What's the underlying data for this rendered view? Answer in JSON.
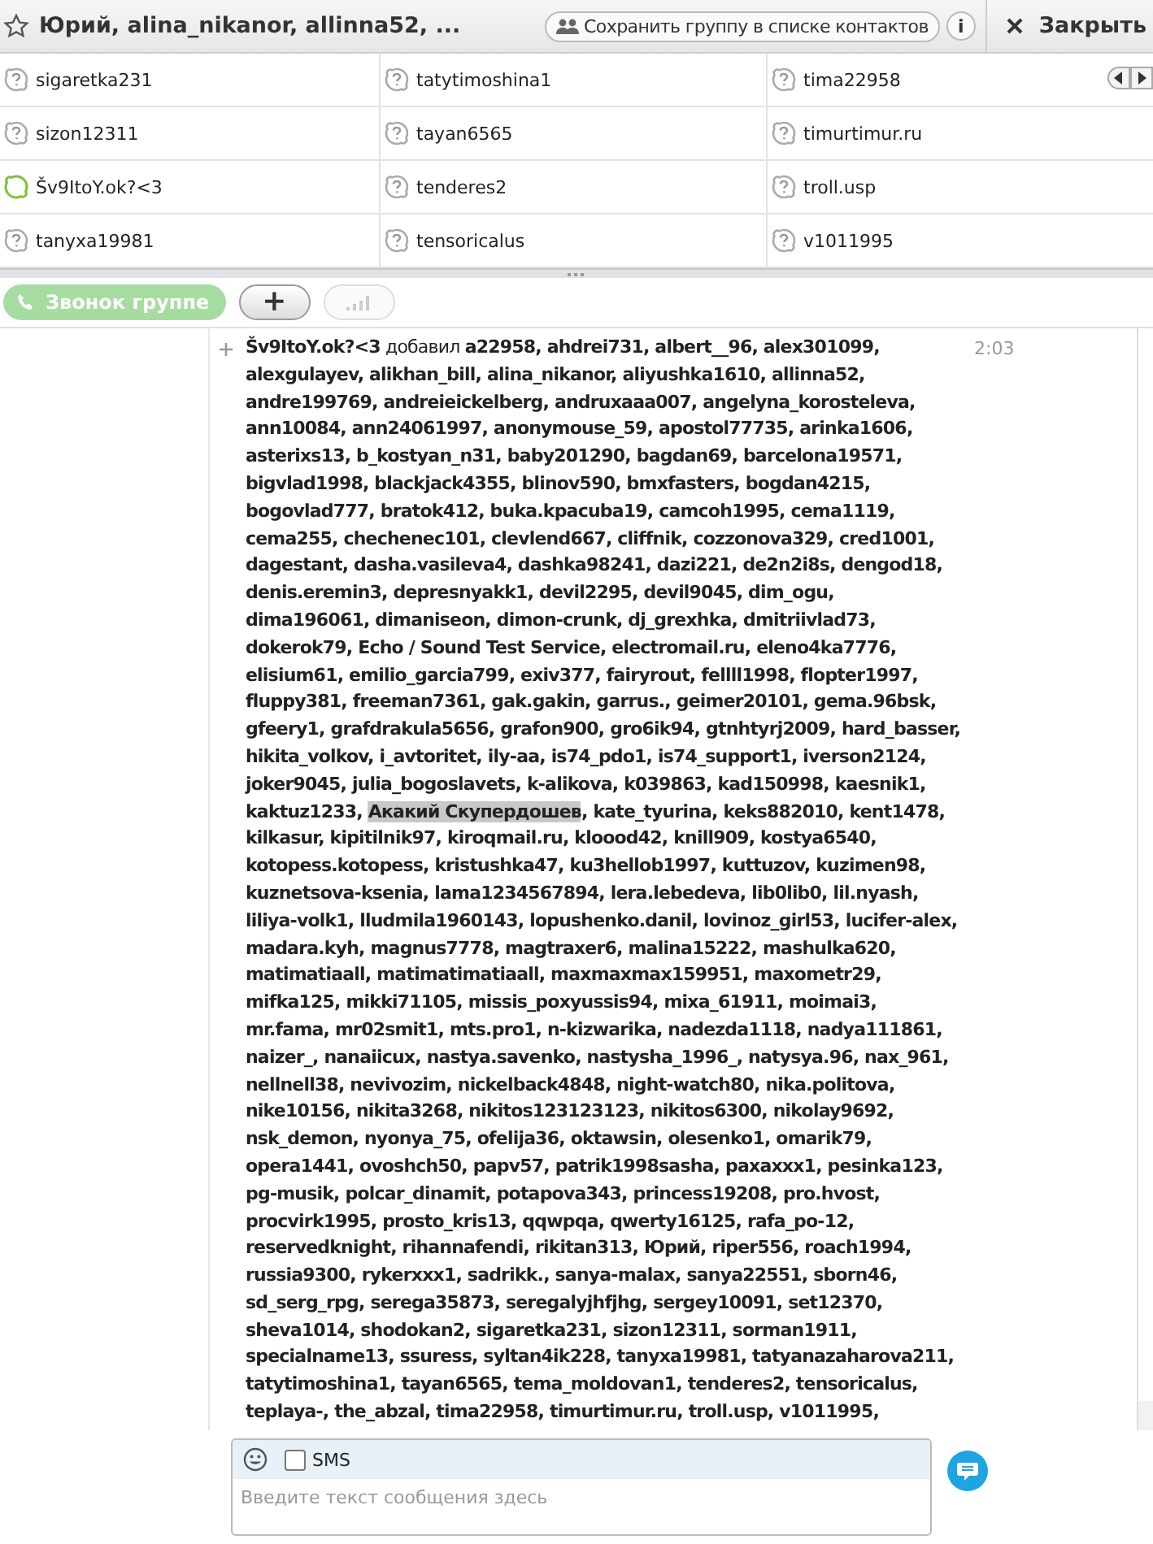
{
  "header": {
    "title": "Юрий, alina_nikanor, allinna52, ...",
    "save_button": "Сохранить группу в списке контактов",
    "info_button": "i",
    "close_button": "Закрыть"
  },
  "contacts": [
    {
      "name": "sigaretka231",
      "kind": "unknown"
    },
    {
      "name": "tatytimoshina1",
      "kind": "unknown"
    },
    {
      "name": "tima22958",
      "kind": "unknown"
    },
    {
      "name": "sizon12311",
      "kind": "unknown"
    },
    {
      "name": "tayan6565",
      "kind": "unknown"
    },
    {
      "name": "timurtimur.ru",
      "kind": "unknown"
    },
    {
      "name": "Šv9ItoY.ok?<3",
      "kind": "online"
    },
    {
      "name": "tenderes2",
      "kind": "unknown"
    },
    {
      "name": "troll.usp",
      "kind": "unknown"
    },
    {
      "name": "tanyxa19981",
      "kind": "unknown"
    },
    {
      "name": "tensoricalus",
      "kind": "unknown"
    },
    {
      "name": "v1011995",
      "kind": "unknown"
    }
  ],
  "toolbar": {
    "call_button": {
      "label": "Звонок группе",
      "disabled": true
    },
    "add_button": {
      "label": "+",
      "disabled": false
    },
    "quality_button": {
      "disabled": true
    }
  },
  "message": {
    "sender": "Šv9ItoY.ok?<3",
    "action": "добавил",
    "names_before": "a22958, ahdrei731, albert__96, alex301099, alexgulayev, alikhan_bill, alina_nikanor, aliyushka1610, allinna52, andre199769, andreieickelberg, andruxaaa007, angelyna_korosteleva, ann10084, ann24061997, anonymouse_59, apostol77735, arinka1606, asterixs13, b_kostyan_n31, baby201290, bagdan69, barcelona19571, bigvlad1998, blackjack4355, blinov590, bmxfasters, bogdan4215, bogovlad777, bratok412, buka.kpacuba19, camcoh1995, cema1119, cema255, chechenec101, clevlend667, cliffnik, cozzonova329, cred1001, dagestant, dasha.vasileva4, dashka98241, dazi221, de2n2i8s, dengod18, denis.eremin3, depresnyakk1, devil2295, devil9045, dim_ogu, dima196061, dimaniseon, dimon-crunk, dj_grexhka, dmitriivlad73, dokerok79, Echo / Sound Test Service, electromail.ru, eleno4ka7776, elisium61, emilio_garcia799, exiv377, fairyrout, fellll1998, flopter1997, fluppy381, freeman7361, gak.gakin, garrus., geimer20101, gema.96bsk, gfeery1, grafdrakula5656, grafon900, gro6ik94, gtnhtyrj2009, hard_basser, hikita_volkov, i_avtoritet, ily-aa, is74_pdo1, is74_support1, iverson2124, joker9045, julia_bogoslavets, k-alikova, k039863, kad150998, kaesnik1, kaktuz1233, ",
    "highlight": "Акакий Скупердошев",
    "names_after": ", kate_tyurina, keks882010, kent1478, kilkasur, kipitilnik97, kiroqmail.ru, kloood42, knill909, kostya6540, kotopess.kotopess, kristushka47, ku3hellob1997, kuttuzov, kuzimen98, kuznetsova-ksenia, lama1234567894, lera.lebedeva, lib0lib0, lil.nyash, liliya-volk1, lludmila1960143, lopushenko.danil, lovinoz_girl53, lucifer-alex, madara.kyh, magnus7778, magtraxer6, malina15222, mashulka620, matimatiaall, matimatimatiaall, maxmaxmax159951, maxometr29, mifka125, mikki71105, missis_poxyussis94, mixa_61911, moimai3, mr.fama, mr02smit1, mts.pro1, n-kizwarika, nadezda1118, nadya111861, naizer_, nanaiicux, nastya.savenko, nastysha_1996_, natysya.96, nax_961, nellnell38, nevivozim, nickelback4848, night-watch80, nika.politova, nike10156, nikita3268, nikitos123123123, nikitos6300, nikolay9692, nsk_demon, nyonya_75, ofelija36, oktawsin, olesenko1, omarik79, opera1441, ovoshch50, papv57, patrik1998sasha, paxaxxx1, pesinka123, pg-musik, polcar_dinamit, potapova343, princess19208, pro.hvost, procvirk1995, prosto_kris13, qqwpqa, qwerty16125, rafa_po-12, reservedknight, rihannafendi, rikitan313, Юрий, riper556, roach1994, russia9300, rykerxxx1, sadrikk., sanya-malax, sanya22551, sborn46, sd_serg_rpg, serega35873, seregalyjhfjhg, sergey10091, set12370, sheva1014, shodokan2, sigaretka231, sizon12311, sorman1911, specialname13, ssuress, syltan4ik228, tanyxa19981, tatyanazaharova211, tatytimoshina1, tayan6565, tema_moldovan1, tenderes2, tensoricalus, teplaya-, the_abzal, tima22958, timurtimur.ru, troll.usp, v1011995,",
    "time": "2:03"
  },
  "composer": {
    "sms_label": "SMS",
    "sms_checked": false,
    "placeholder": "Введите текст сообщения здесь"
  }
}
